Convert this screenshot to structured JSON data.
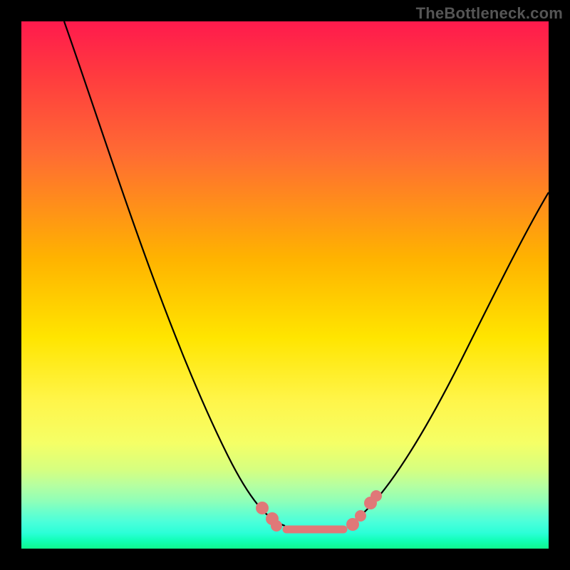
{
  "watermark": "TheBottleneck.com",
  "chart_data": {
    "type": "line",
    "title": "",
    "xlabel": "",
    "ylabel": "",
    "xlim": [
      0,
      100
    ],
    "ylim": [
      0,
      100
    ],
    "series": [
      {
        "name": "curve",
        "x": [
          8,
          12,
          16,
          20,
          24,
          28,
          32,
          36,
          40,
          44,
          47,
          50,
          53,
          56,
          58,
          60,
          64,
          68,
          72,
          76,
          80,
          84,
          88,
          92,
          96,
          100
        ],
        "values": [
          100,
          90,
          80,
          70,
          60,
          50,
          41,
          33,
          25,
          18,
          12,
          7,
          4,
          2,
          1,
          1,
          2,
          5,
          10,
          16,
          23,
          30,
          37,
          45,
          53,
          61
        ]
      }
    ],
    "flat_region_x": [
      48,
      62
    ],
    "marker_dots_x": [
      45.5,
      48,
      50,
      54,
      58,
      62,
      64.5,
      67
    ],
    "background_gradient": {
      "top": "#ff1a4d",
      "bottom": "#10f78d"
    }
  }
}
